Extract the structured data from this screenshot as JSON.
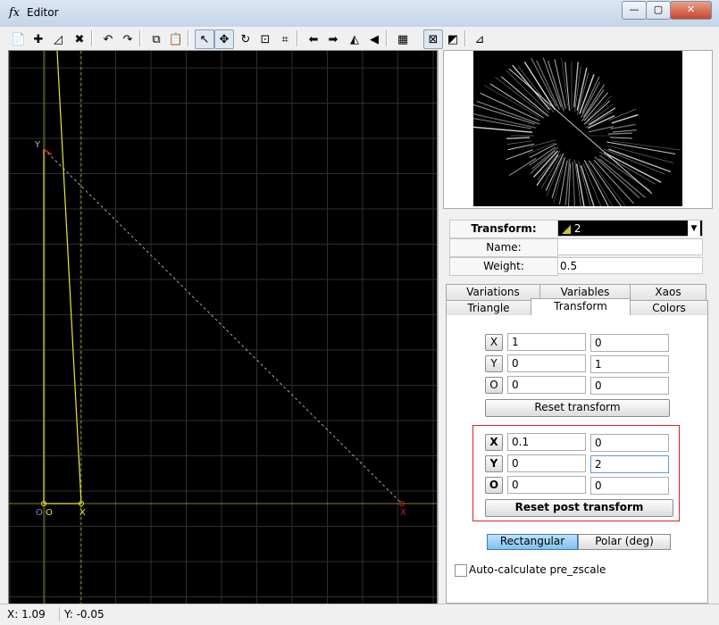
{
  "window": {
    "app_icon": "fx",
    "title": "Editor",
    "controls": {
      "minimize": "—",
      "maximize": "▢",
      "close": "✕"
    }
  },
  "toolbar": {
    "buttons": [
      {
        "name": "new-icon",
        "glyph": "📄"
      },
      {
        "name": "add-transform-icon",
        "glyph": "✚"
      },
      {
        "name": "duplicate-transform-icon",
        "glyph": "◿"
      },
      {
        "name": "delete-transform-icon",
        "glyph": "✖"
      },
      {
        "name": "undo-icon",
        "glyph": "↶"
      },
      {
        "name": "redo-icon",
        "glyph": "↷"
      },
      {
        "name": "copy-icon",
        "glyph": "⧉"
      },
      {
        "name": "paste-icon",
        "glyph": "📋"
      },
      {
        "name": "select-pointer-icon",
        "glyph": "↖"
      },
      {
        "name": "move-icon",
        "glyph": "✥"
      },
      {
        "name": "rotate-icon",
        "glyph": "↻"
      },
      {
        "name": "scale-icon",
        "glyph": "⊡"
      },
      {
        "name": "fit-icon",
        "glyph": "⌗"
      },
      {
        "name": "rotate-left-icon",
        "glyph": "⬅"
      },
      {
        "name": "rotate-right-icon",
        "glyph": "➡"
      },
      {
        "name": "flip-horizontal-icon",
        "glyph": "◭"
      },
      {
        "name": "flip-vertical-icon",
        "glyph": "◀"
      },
      {
        "name": "grid-icon",
        "glyph": "▦"
      },
      {
        "name": "post-transform-toggle-icon",
        "glyph": "⊠"
      },
      {
        "name": "pre-transform-toggle-icon",
        "glyph": "◩"
      },
      {
        "name": "options-icon",
        "glyph": "⊿"
      }
    ]
  },
  "canvas": {
    "labels": {
      "y_top": "Y",
      "x_right": "X",
      "o_origin": "O",
      "x_near": "X",
      "o_left": "O"
    },
    "colors": {
      "background": "#000000",
      "grid": "#2e2e2e",
      "triangle": "#e8e830",
      "post_triangle": "#d02020"
    }
  },
  "transform_panel": {
    "transform": {
      "label": "Transform:",
      "value": "2"
    },
    "name": {
      "label": "Name:",
      "value": ""
    },
    "weight": {
      "label": "Weight:",
      "value": "0.5"
    }
  },
  "tabs": {
    "row1": [
      "Variations",
      "Variables",
      "Xaos"
    ],
    "row2": [
      "Triangle",
      "Transform",
      "Colors"
    ],
    "selected": "Transform"
  },
  "pre_transform": {
    "rows": [
      {
        "key": "X",
        "a": "1",
        "b": "0"
      },
      {
        "key": "Y",
        "a": "0",
        "b": "1"
      },
      {
        "key": "O",
        "a": "0",
        "b": "0"
      }
    ],
    "reset_label": "Reset transform"
  },
  "post_transform": {
    "rows": [
      {
        "key": "X",
        "a": "0.1",
        "b": "0"
      },
      {
        "key": "Y",
        "a": "0",
        "b": "2"
      },
      {
        "key": "O",
        "a": "0",
        "b": "0"
      }
    ],
    "reset_label": "Reset post transform"
  },
  "coords": {
    "rectangular": "Rectangular",
    "polar": "Polar (deg)",
    "selected": "Rectangular"
  },
  "auto_calc": {
    "label": "Auto-calculate pre_zscale",
    "checked": false
  },
  "status": {
    "x": "X: 1.09",
    "y": "Y: -0.05"
  }
}
